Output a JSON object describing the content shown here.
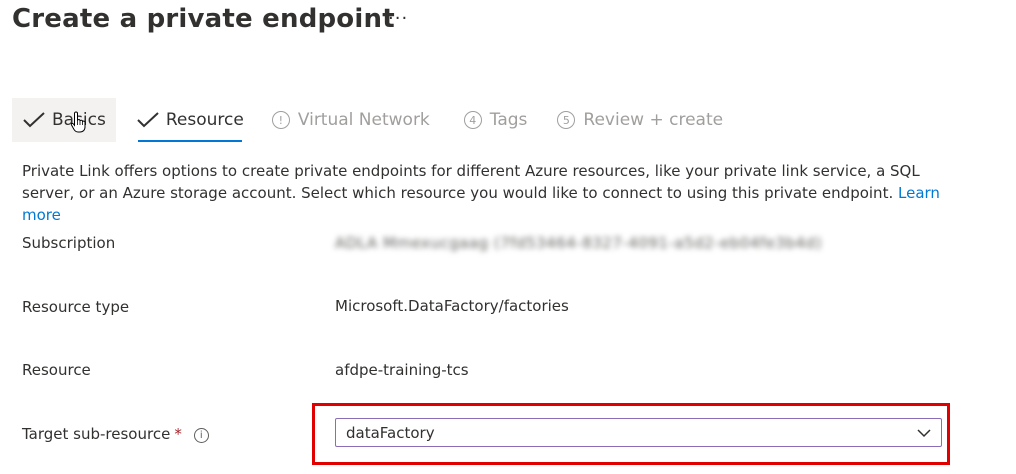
{
  "header": {
    "title": "Create a private endpoint",
    "more_label": "···"
  },
  "tabs": [
    {
      "label": "Basics",
      "state": "complete",
      "marker": "check"
    },
    {
      "label": "Resource",
      "state": "active",
      "marker": "check"
    },
    {
      "label": "Virtual Network",
      "state": "disabled",
      "marker": "!"
    },
    {
      "label": "Tags",
      "state": "disabled",
      "marker": "4"
    },
    {
      "label": "Review + create",
      "state": "disabled",
      "marker": "5"
    }
  ],
  "description": {
    "text": "Private Link offers options to create private endpoints for different Azure resources, like your private link service, a SQL server, or an Azure storage account. Select which resource you would like to connect to using this private endpoint.",
    "learn_more": "Learn more"
  },
  "fields": {
    "subscription": {
      "label": "Subscription",
      "value": "ADLA Mmexucgaag (7fd53464-8327-4091-a5d2-eb04fe3b4d)"
    },
    "resource_type": {
      "label": "Resource type",
      "value": "Microsoft.DataFactory/factories"
    },
    "resource": {
      "label": "Resource",
      "value": "afdpe-training-tcs"
    },
    "target_sub_resource": {
      "label": "Target sub-resource",
      "required_mark": "*",
      "info_icon": "i",
      "value": "dataFactory"
    }
  },
  "colors": {
    "accent": "#0078d4",
    "highlight": "#e00000",
    "required": "#a4262c",
    "disabled": "#a19f9d"
  },
  "icons": {
    "check": "checkmark-icon",
    "info": "info-icon",
    "dropdown": "chevron-down-icon",
    "cursor": "hand-cursor-icon"
  }
}
